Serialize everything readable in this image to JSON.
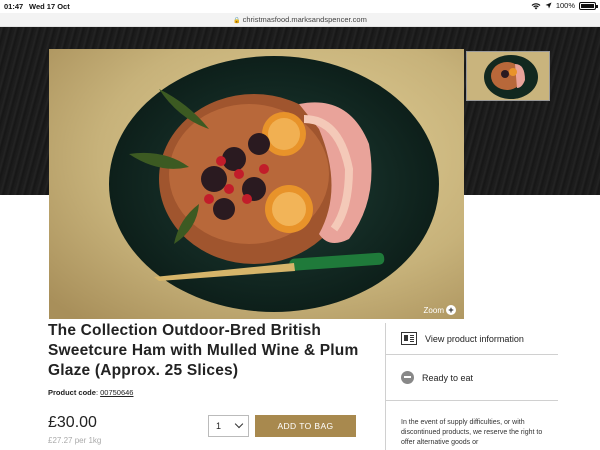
{
  "status_bar": {
    "time": "01:47",
    "date": "Wed 17 Oct",
    "battery": "100%"
  },
  "browser": {
    "url": "christmasfood.marksandspencer.com"
  },
  "gallery": {
    "zoom_label": "Zoom"
  },
  "product": {
    "title": "The Collection Outdoor-Bred British Sweetcure Ham with Mulled Wine & Plum Glaze (Approx. 25 Slices)",
    "code_label": "Product code",
    "code_value": "00750646",
    "price": "£30.00",
    "unit_price": "£27.27 per 1kg"
  },
  "purchase": {
    "quantity": "1",
    "add_label": "ADD TO BAG"
  },
  "side_panel": {
    "info_label": "View product information",
    "ready_label": "Ready to eat",
    "notice": "In the event of supply difficulties, or with discontinued products, we reserve the right to offer alternative goods or"
  },
  "colors": {
    "accent": "#a8894e",
    "hero_bg": "#1e1e1e"
  }
}
